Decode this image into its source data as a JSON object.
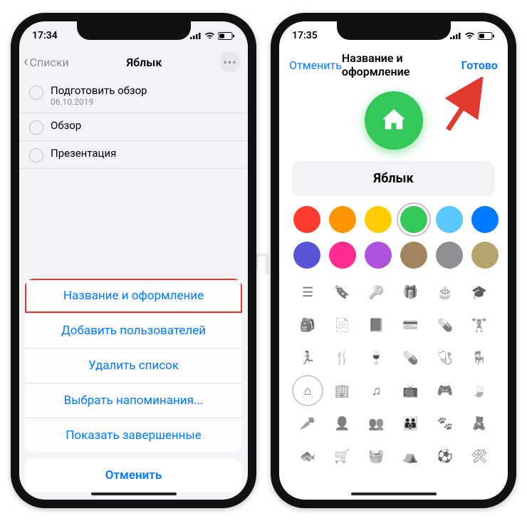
{
  "watermark": "яБлык",
  "left": {
    "time": "17:34",
    "back_label": "Списки",
    "screen_title": "Яблык",
    "reminders": [
      {
        "title": "Подготовить обзор",
        "subtitle": "06.10.2019"
      },
      {
        "title": "Обзор",
        "subtitle": ""
      },
      {
        "title": "Презентация",
        "subtitle": ""
      }
    ],
    "sheet": {
      "items": [
        "Название и оформление",
        "Добавить пользователей",
        "Удалить список",
        "Выбрать напоминания...",
        "Показать завершенные"
      ],
      "highlight_index": 0,
      "cancel": "Отменить"
    }
  },
  "right": {
    "time": "17:35",
    "cancel": "Отменить",
    "title": "Название и оформление",
    "done": "Готово",
    "list_name": "Яблык",
    "selected_icon": "house-icon",
    "colors": [
      {
        "name": "red",
        "hex": "#ff3b30"
      },
      {
        "name": "orange",
        "hex": "#ff9500"
      },
      {
        "name": "yellow",
        "hex": "#ffcc00"
      },
      {
        "name": "green",
        "hex": "#34c759",
        "selected": true
      },
      {
        "name": "lightblue",
        "hex": "#5ac8fa"
      },
      {
        "name": "blue",
        "hex": "#007aff"
      },
      {
        "name": "indigo",
        "hex": "#5856d6"
      },
      {
        "name": "pink",
        "hex": "#ff2d92"
      },
      {
        "name": "purple",
        "hex": "#af52de"
      },
      {
        "name": "brown",
        "hex": "#a2845e"
      },
      {
        "name": "gray",
        "hex": "#8e8e93"
      },
      {
        "name": "khaki",
        "hex": "#b6a46f"
      }
    ],
    "icons": [
      "list-icon",
      "bookmark-icon",
      "key-icon",
      "gift-icon",
      "cake-icon",
      "graduation-icon",
      "backpack-icon",
      "document-icon",
      "book-icon",
      "creditcard-icon",
      "pills-icon",
      "dumbbell-icon",
      "runner-icon",
      "cutlery-icon",
      "wineglass-icon",
      "pill-icon",
      "stethoscope-icon",
      "chair-icon",
      "house-icon",
      "building-icon",
      "music-icon",
      "tv-icon",
      "gamepad-icon",
      "leaf-icon",
      "carrot-icon",
      "person-icon",
      "people-icon",
      "family-icon",
      "paw-icon",
      "teddy-icon",
      "fish-icon",
      "cart-icon",
      "basket-icon",
      "tent-icon",
      "soccer-icon",
      "tools-icon"
    ],
    "selected_icon_index": 18
  }
}
